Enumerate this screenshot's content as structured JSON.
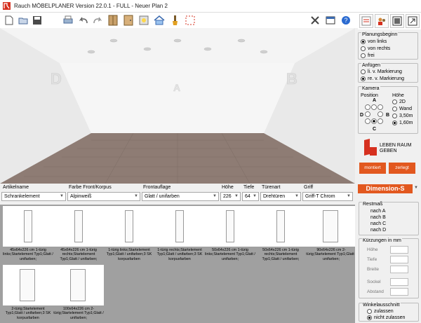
{
  "titlebar": {
    "title": "Rauch MÖBELPLANER Version 22.0.1 - FULL - Neuer Plan 2",
    "logo_color": "#d6301f"
  },
  "toolbar": {
    "icons": [
      "new-file-icon",
      "open-file-icon",
      "save-icon",
      "print-icon",
      "undo-icon",
      "redo-icon",
      "wardrobe-icon",
      "wardrobe-door-icon",
      "room-light-icon",
      "house-icon",
      "brush-icon",
      "selection-grid-icon"
    ]
  },
  "right_toolbar": {
    "icons": [
      "planner-icon",
      "users-icon",
      "window-icon",
      "export-icon",
      "settings-icon",
      "help-icon"
    ]
  },
  "room": {
    "wall_labels": [
      "D",
      "A",
      "B"
    ],
    "floor_color": "#8a7870",
    "wall_color": "#f2f2f2"
  },
  "planungsbeginn": {
    "title": "Planungsbeginn",
    "options": [
      "von links",
      "von rechts",
      "frei"
    ],
    "selected": 0
  },
  "anfuegen": {
    "title": "Anfügen",
    "options": [
      "li. v. Markierung",
      "re. v. Markierung"
    ],
    "selected": 1
  },
  "kamera": {
    "title": "Kamera",
    "position_label": "Position",
    "hoehe_label": "Höhe",
    "pos_a": "A",
    "pos_b": "B",
    "pos_c": "C",
    "pos_d": "D",
    "heights": [
      "2D",
      "Wand",
      "3,50m",
      "1,60m"
    ],
    "selected_height": 3
  },
  "brand": {
    "logo_text_1": "LEBEN RAUM",
    "logo_text_2": "GEBEN",
    "btn_montiert": "montiert",
    "btn_zerlegt": "zerlegt",
    "accent": "#e2581f"
  },
  "properties": {
    "headers": [
      "Artikelname",
      "Farbe Front/Korpus",
      "Frontauflage",
      "Höhe",
      "Tiefe",
      "Türenart",
      "Griff"
    ],
    "values": [
      "Schrankelement",
      "Alpinweiß",
      "Glatt / unifarben",
      "226",
      "64",
      "Drehtüren",
      "Griff-T Chrom"
    ]
  },
  "dimension": {
    "label": "Dimension-S"
  },
  "restmass": {
    "title": "Restmaß",
    "items": [
      "nach A",
      "nach B",
      "nach C",
      "nach D"
    ]
  },
  "kuerzungen": {
    "title": "Kürzungen in mm",
    "fields": [
      "Höhe",
      "Tiefe",
      "Breite",
      "Sockel",
      "Abstand"
    ]
  },
  "winkelausschnitt": {
    "title": "Winkelausschnitt",
    "options": [
      "zulassen",
      "nicht zulassen"
    ],
    "selected": 1
  },
  "catalog": {
    "items": [
      {
        "caption": "45x64x226 cm 1-türig links;Startelement Typ1;Glatt / unifarben;"
      },
      {
        "caption": "45x64x226 cm 1-türig rechts;Startelement Typ1;Glatt / unifarben;"
      },
      {
        "caption": "1-türig links;Startelement Typ1;Glatt / unifarben;3 SK korpusfarben"
      },
      {
        "caption": "1-türig rechts;Startelement Typ1;Glatt / unifarben;3 SK korpusfarben"
      },
      {
        "caption": "50x64x226 cm 1-türig links;Startelement Typ1;Glatt / unifarben;"
      },
      {
        "caption": "50x64x226 cm 1-türig rechts;Startelement Typ1;Glatt / unifarben;"
      },
      {
        "caption": "90x64x226 cm 2-türig;Startelement Typ1;Glatt / unifarben;"
      },
      {
        "caption": "2-türig;Startelement Typ1;Glatt / unifarben;3 SK korpusfarben"
      },
      {
        "caption": "100x64x226 cm 2-türig;Startelement Typ1;Glatt / unifarben;"
      }
    ]
  }
}
